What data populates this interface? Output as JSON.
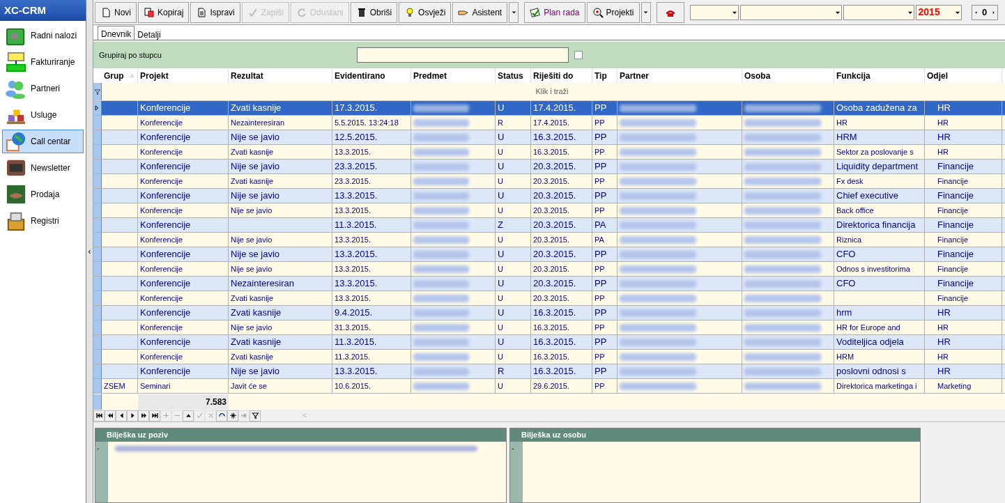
{
  "app_title": "XC-CRM",
  "sidebar": {
    "items": [
      {
        "label": "Radni nalozi",
        "selected": false
      },
      {
        "label": "Fakturiranje",
        "selected": false
      },
      {
        "label": "Partneri",
        "selected": false
      },
      {
        "label": "Usluge",
        "selected": false
      },
      {
        "label": "Call centar",
        "selected": true
      },
      {
        "label": "Newsletter",
        "selected": false
      },
      {
        "label": "Prodaja",
        "selected": false
      },
      {
        "label": "Registri",
        "selected": false
      }
    ]
  },
  "collapse_arrow": "‹",
  "toolbar": {
    "buttons": [
      {
        "label": "Novi",
        "disabled": false
      },
      {
        "label": "Kopiraj",
        "disabled": false
      },
      {
        "label": "Ispravi",
        "disabled": false
      },
      {
        "label": "Zapiši",
        "disabled": true
      },
      {
        "label": "Odustani",
        "disabled": true
      },
      {
        "label": "Obriši",
        "disabled": false
      },
      {
        "label": "Osvježi",
        "disabled": false
      },
      {
        "label": "Asistent",
        "disabled": false
      },
      {
        "label": "Plan rada",
        "disabled": false
      },
      {
        "label": "Projekti",
        "disabled": false
      }
    ],
    "year_combo": {
      "value": "2015"
    },
    "spinner": {
      "value": "0"
    }
  },
  "tabs": [
    {
      "label": "Dnevnik",
      "selected": true
    },
    {
      "label": "Detalji",
      "selected": false
    }
  ],
  "group_panel": {
    "label": "Grupiraj po stupcu",
    "checked": false
  },
  "table": {
    "columns": [
      "Grup",
      "Projekt",
      "Rezultat",
      "Evidentirano",
      "Predmet",
      "Status",
      "Riješiti do",
      "Tip",
      "Partner",
      "Osoba",
      "Funkcija",
      "Odjel"
    ],
    "filter_hint": "Klik i traži",
    "rows": [
      {
        "projekt": "Konferencije",
        "rezultat": "Zvati kasnije",
        "evidentirano": "17.3.2015.",
        "status": "U",
        "rijesiti_do": "17.4.2015.",
        "tip": "PP",
        "funkcija": "Osoba zadužena za",
        "odjel": "HR",
        "kind": "large",
        "selected": true
      },
      {
        "projekt": "Konferencije",
        "rezultat": "Nezainteresiran",
        "evidentirano": "5.5.2015. 13:24:18",
        "status": "R",
        "rijesiti_do": "17.4.2015.",
        "tip": "PP",
        "funkcija": "HR",
        "odjel": "HR",
        "kind": "small",
        "selected": false
      },
      {
        "projekt": "Konferencije",
        "rezultat": "Nije se javio",
        "evidentirano": "12.5.2015.",
        "status": "U",
        "rijesiti_do": "16.3.2015.",
        "tip": "PP",
        "funkcija": "HRM",
        "odjel": "HR",
        "kind": "large",
        "selected": false
      },
      {
        "projekt": "Konferencije",
        "rezultat": "Zvati kasnije",
        "evidentirano": "13.3.2015.",
        "status": "U",
        "rijesiti_do": "16.3.2015.",
        "tip": "PP",
        "funkcija": "Sektor za poslovanje s",
        "odjel": "HR",
        "kind": "small",
        "selected": false
      },
      {
        "projekt": "Konferencije",
        "rezultat": "Nije se javio",
        "evidentirano": "23.3.2015.",
        "status": "U",
        "rijesiti_do": "20.3.2015.",
        "tip": "PP",
        "funkcija": "Liquidity department",
        "odjel": "Financije",
        "kind": "large",
        "selected": false
      },
      {
        "projekt": "Konferencije",
        "rezultat": "Zvati kasnije",
        "evidentirano": "23.3.2015.",
        "status": "U",
        "rijesiti_do": "20.3.2015.",
        "tip": "PP",
        "funkcija": "Fx desk",
        "odjel": "Financije",
        "kind": "small",
        "selected": false
      },
      {
        "projekt": "Konferencije",
        "rezultat": "Nije se javio",
        "evidentirano": "13.3.2015.",
        "status": "U",
        "rijesiti_do": "20.3.2015.",
        "tip": "PP",
        "funkcija": "Chief executive",
        "odjel": "Financije",
        "kind": "large",
        "selected": false
      },
      {
        "projekt": "Konferencije",
        "rezultat": "Nije se javio",
        "evidentirano": "13.3.2015.",
        "status": "U",
        "rijesiti_do": "20.3.2015.",
        "tip": "PP",
        "funkcija": "Back office",
        "odjel": "Financije",
        "kind": "small",
        "selected": false
      },
      {
        "projekt": "Konferencije",
        "evidentirano": "11.3.2015.",
        "status": "Z",
        "rijesiti_do": "20.3.2015.",
        "tip": "PA",
        "funkcija": "Direktorica financija",
        "odjel": "Financije",
        "kind": "large",
        "selected": false
      },
      {
        "projekt": "Konferencije",
        "rezultat": "Nije se javio",
        "evidentirano": "13.3.2015.",
        "status": "U",
        "rijesiti_do": "20.3.2015.",
        "tip": "PA",
        "funkcija": "Riznica",
        "odjel": "Financije",
        "kind": "small",
        "selected": false
      },
      {
        "projekt": "Konferencije",
        "rezultat": "Nije se javio",
        "evidentirano": "13.3.2015.",
        "status": "U",
        "rijesiti_do": "20.3.2015.",
        "tip": "PP",
        "funkcija": "CFO",
        "odjel": "Financije",
        "kind": "large",
        "selected": false
      },
      {
        "projekt": "Konferencije",
        "rezultat": "Nije se javio",
        "evidentirano": "13.3.2015.",
        "status": "U",
        "rijesiti_do": "20.3.2015.",
        "tip": "PP",
        "funkcija": "Odnos s investitorima",
        "odjel": "Financije",
        "kind": "small",
        "selected": false
      },
      {
        "projekt": "Konferencije",
        "rezultat": "Nezainteresiran",
        "evidentirano": "13.3.2015.",
        "status": "U",
        "rijesiti_do": "20.3.2015.",
        "tip": "PP",
        "funkcija": "CFO",
        "odjel": "Financije",
        "kind": "large",
        "selected": false
      },
      {
        "projekt": "Konferencije",
        "rezultat": "Zvati kasnije",
        "evidentirano": "13.3.2015.",
        "status": "U",
        "rijesiti_do": "20.3.2015.",
        "tip": "PP",
        "odjel": "Financije",
        "kind": "small",
        "selected": false
      },
      {
        "projekt": "Konferencije",
        "rezultat": "Zvati kasnije",
        "evidentirano": "9.4.2015.",
        "status": "U",
        "rijesiti_do": "16.3.2015.",
        "tip": "PP",
        "funkcija": "hrm",
        "odjel": "HR",
        "kind": "large",
        "selected": false
      },
      {
        "projekt": "Konferencije",
        "rezultat": "Nije se javio",
        "evidentirano": "31.3.2015.",
        "status": "U",
        "rijesiti_do": "16.3.2015.",
        "tip": "PP",
        "funkcija": "HR for Europe and",
        "odjel": "HR",
        "kind": "small",
        "selected": false
      },
      {
        "projekt": "Konferencije",
        "rezultat": "Zvati kasnije",
        "evidentirano": "11.3.2015.",
        "status": "U",
        "rijesiti_do": "16.3.2015.",
        "tip": "PP",
        "funkcija": "Voditeljica odjela",
        "odjel": "HR",
        "kind": "large",
        "selected": false
      },
      {
        "projekt": "Konferencije",
        "rezultat": "Zvati kasnije",
        "evidentirano": "11.3.2015.",
        "status": "U",
        "rijesiti_do": "16.3.2015.",
        "tip": "PP",
        "funkcija": "HRM",
        "odjel": "HR",
        "kind": "small",
        "selected": false
      },
      {
        "projekt": "Konferencije",
        "rezultat": "Nije se javio",
        "evidentirano": "13.3.2015.",
        "status": "R",
        "rijesiti_do": "16.3.2015.",
        "tip": "PP",
        "funkcija": "poslovni odnosi s",
        "odjel": "HR",
        "kind": "large",
        "selected": false
      },
      {
        "grup": "ZSEM",
        "projekt": "Seminari",
        "rezultat": "Javit će se",
        "evidentirano": "10.6.2015.",
        "status": "U",
        "rijesiti_do": "29.6.2015.",
        "tip": "PP",
        "funkcija": "Direktorica marketinga i",
        "odjel": "Marketing",
        "kind": "small",
        "selected": false
      }
    ],
    "total": "7.583"
  },
  "navigator": [
    {
      "kind": "first",
      "disabled": false
    },
    {
      "kind": "prev_page",
      "disabled": false
    },
    {
      "kind": "prev",
      "disabled": false
    },
    {
      "kind": "next",
      "disabled": false
    },
    {
      "kind": "next_page",
      "disabled": false
    },
    {
      "kind": "last",
      "disabled": false
    },
    {
      "kind": "insert",
      "disabled": true
    },
    {
      "kind": "delete",
      "disabled": true
    },
    {
      "kind": "edit",
      "disabled": false
    },
    {
      "kind": "post",
      "disabled": true
    },
    {
      "kind": "cancel",
      "disabled": true
    },
    {
      "kind": "refresh",
      "disabled": false
    },
    {
      "kind": "bookmark",
      "disabled": false
    },
    {
      "kind": "goto_bookmark",
      "disabled": true
    },
    {
      "kind": "filter",
      "disabled": false
    }
  ],
  "scroll_arrow": "<",
  "notes": [
    {
      "title": "Bilješka uz poziv",
      "marker": "-",
      "blurred": true
    },
    {
      "title": "Bilješka uz osobu",
      "marker": "-",
      "blurred": false
    }
  ]
}
